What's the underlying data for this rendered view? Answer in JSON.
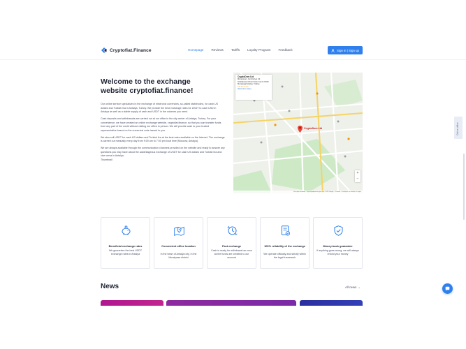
{
  "header": {
    "logo_text": "Cryptofiat.Finance",
    "nav": [
      "Homepage",
      "Reviews",
      "Tariffs",
      "Loyalty Program",
      "Feedback"
    ],
    "active_nav": "Homepage",
    "signin_label": "Sign in  |  Sign up"
  },
  "hero": {
    "title": "Welcome to the exchange website cryptofiat.finance!",
    "paragraphs": [
      "Our online service specializes in the exchange of electronic currencies, so-called stablecoins, for cash US dollars and Turkish lira in Antalya, Turkey. We provide the best exchange rates for USDT to cash USD in Antalya as well as a stable supply of cash and USDT in the volumes you need.",
      "Cash deposits and withdrawals are carried out at our office in the city center of Antalya, Turkey. For your convenience, we have created an online exchange website, cryptofiat.finance, so that you can transfer funds from any part of the world without visiting our office in person. We will provide cash to your trusted representative based on the numerical code issued to you.",
      "We also sell USDT for cash US dollars and Turkish lira at the best rates available on the Internet. The exchange is carried out manually every day from 9:00 am to 7:00 pm local time (Moscow, Antalya).",
      "We are always available through the communication channels provided on the website and ready to answer any questions you may have about the advantageous exchange of USDT for cash US dollars and Turkish lira and vice versa in Antalya.",
      "Thumbnail"
    ]
  },
  "map": {
    "card_title": "CryptoDom Ltd",
    "card_address": "Mimarsinan, Cumhuriyet Cd. Sinkiskavat, Mimar Sinan Kat:4, 07040 Muratpaşa/Antalya, Türkiye",
    "card_rating": "4.8 ★★★★★",
    "card_link": "Увеличить карту",
    "pin_label": "CryptoDom Ltd",
    "zoom_in": "+",
    "zoom_out": "−",
    "footer": "Быстрые клавиши · Картографические данные ©2023 Google · Условия · Сообщить об ошибке на карте"
  },
  "side_tab": "Online office",
  "features": [
    {
      "icon": "piggy-bank-icon",
      "title": "Beneficial exchange rates",
      "desc": "We guarantee the best USDT exchange rates in Antalya"
    },
    {
      "icon": "map-location-icon",
      "title": "Convenient office location",
      "desc": "In the heart of Antalya city, in the Muratpasa district"
    },
    {
      "icon": "clock-exchange-icon",
      "title": "Fast exchange",
      "desc": "Cash is ready for withdrawal as soon as the funds are credited to our account"
    },
    {
      "icon": "document-check-icon",
      "title": "100% reliability of the exchange",
      "desc": "We operate officially and strictly within the legal framework"
    },
    {
      "icon": "shield-check-icon",
      "title": "Money-back guarantee",
      "desc": "If anything goes wrong, we will always refund your money"
    }
  ],
  "news": {
    "title": "News",
    "all_label": "All news  →"
  },
  "colors": {
    "accent": "#2f80ed",
    "news_card_1": "#b0178f",
    "news_card_2": "#7b2aa8",
    "news_card_3": "#2a2f9e"
  }
}
